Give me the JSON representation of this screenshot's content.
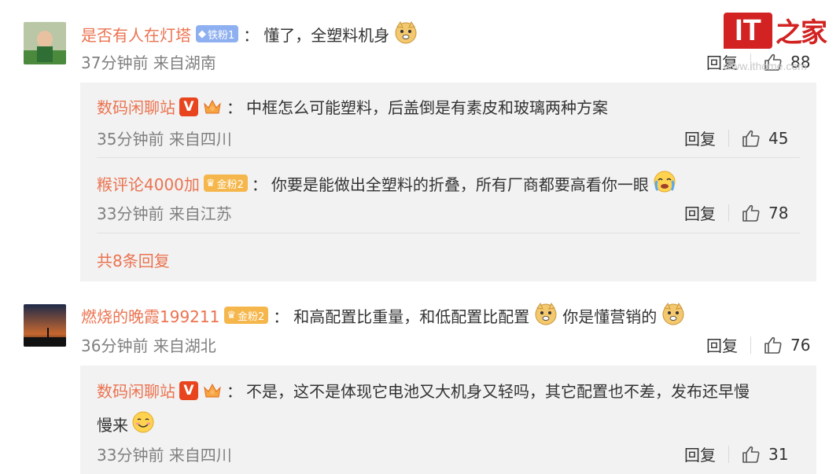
{
  "comments": [
    {
      "user": "是否有人在灯塔",
      "badge": "铁粉1",
      "text": "懂了，全塑料机身",
      "meta": "37分钟前 来自湖南",
      "reply_label": "回复",
      "likes": "88",
      "replies": [
        {
          "user": "数码闲聊站",
          "text": "中框怎么可能塑料，后盖倒是有素皮和玻璃两种方案",
          "meta": "35分钟前 来自四川",
          "reply_label": "回复",
          "likes": "45"
        },
        {
          "user": "糇评论4000加",
          "badge": "金粉2",
          "text": "你要是能做出全塑料的折叠，所有厂商都要高看你一眼",
          "meta": "33分钟前 来自江苏",
          "reply_label": "回复",
          "likes": "78"
        }
      ],
      "more_replies": "共8条回复"
    },
    {
      "user": "燃烧的晚霞199211",
      "badge": "金粉2",
      "text_a": "和高配置比重量，和低配置比配置",
      "text_b": "你是懂营销的",
      "meta": "36分钟前 来自湖北",
      "reply_label": "回复",
      "likes": "76",
      "replies": [
        {
          "user": "数码闲聊站",
          "text_line1": "不是，这不是体现它电池又大机身又轻吗，其它配置也不差，发布还早慢",
          "text_line2": "慢来",
          "meta": "33分钟前 来自四川",
          "reply_label": "回复",
          "likes": "31"
        }
      ]
    }
  ],
  "colon": "：",
  "watermark": {
    "logo_it": "IT",
    "logo_home": "之家",
    "url": "www.ithome.com"
  },
  "colors": {
    "username": "#eb7350",
    "reply_bg": "#f2f2f2",
    "logo_red": "#d22222"
  }
}
